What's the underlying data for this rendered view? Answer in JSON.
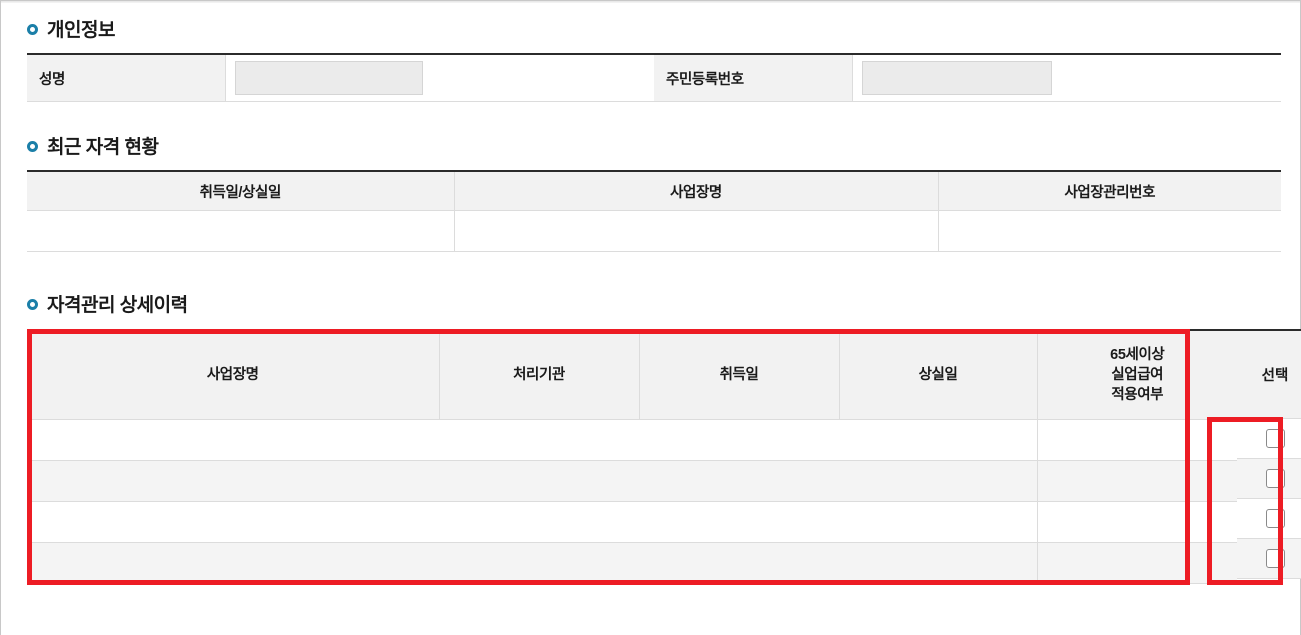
{
  "sections": {
    "personal_info": {
      "title": "개인정보",
      "bullet_icon": "circle-ring-icon",
      "fields": [
        {
          "label": "성명",
          "value": "",
          "placeholder": ""
        },
        {
          "label": "주민등록번호",
          "value": "",
          "placeholder": ""
        }
      ]
    },
    "recent_status": {
      "title": "최근 자격 현황",
      "bullet_icon": "circle-ring-icon",
      "columns": [
        "취득일/상실일",
        "사업장명",
        "사업장관리번호"
      ],
      "rows": [
        {
          "cells": [
            "",
            "",
            ""
          ]
        }
      ]
    },
    "detail_history": {
      "title": "자격관리 상세이력",
      "bullet_icon": "circle-ring-icon",
      "columns": [
        "사업장명",
        "처리기관",
        "취득일",
        "상실일",
        "65세이상\n실업급여\n적용여부"
      ],
      "age_column_lines": [
        "65세이상",
        "실업급여",
        "적용여부"
      ],
      "select_column_label": "선택",
      "rows": [
        {
          "company": "",
          "agency": "",
          "acquire_date": "",
          "loss_date": "",
          "age65_applied": "",
          "selected": false
        },
        {
          "company": "",
          "agency": "",
          "acquire_date": "",
          "loss_date": "",
          "age65_applied": "",
          "selected": false
        },
        {
          "company": "",
          "agency": "",
          "acquire_date": "",
          "loss_date": "",
          "age65_applied": "",
          "selected": false
        },
        {
          "company": "",
          "agency": "",
          "acquire_date": "",
          "loss_date": "",
          "age65_applied": "",
          "selected": false
        }
      ],
      "scrollbar": {
        "up_arrow_icon": "triangle-up-icon",
        "down_arrow_icon": "triangle-down-icon",
        "thumb_icon": "scroll-thumb"
      }
    }
  },
  "annotations": [
    {
      "name": "grid-highlight",
      "color": "#ed1c24"
    },
    {
      "name": "select-column-highlight",
      "color": "#ed1c24"
    }
  ],
  "colors": {
    "bullet": "#1b7fa8",
    "header_bg": "#f2f2f2",
    "alt_row_bg": "#f4f4f4",
    "border": "#dcdcdc",
    "table_top_border": "#2b2b2b",
    "readonly_input_bg": "#ebebeb",
    "annotation_red": "#ed1c24"
  }
}
